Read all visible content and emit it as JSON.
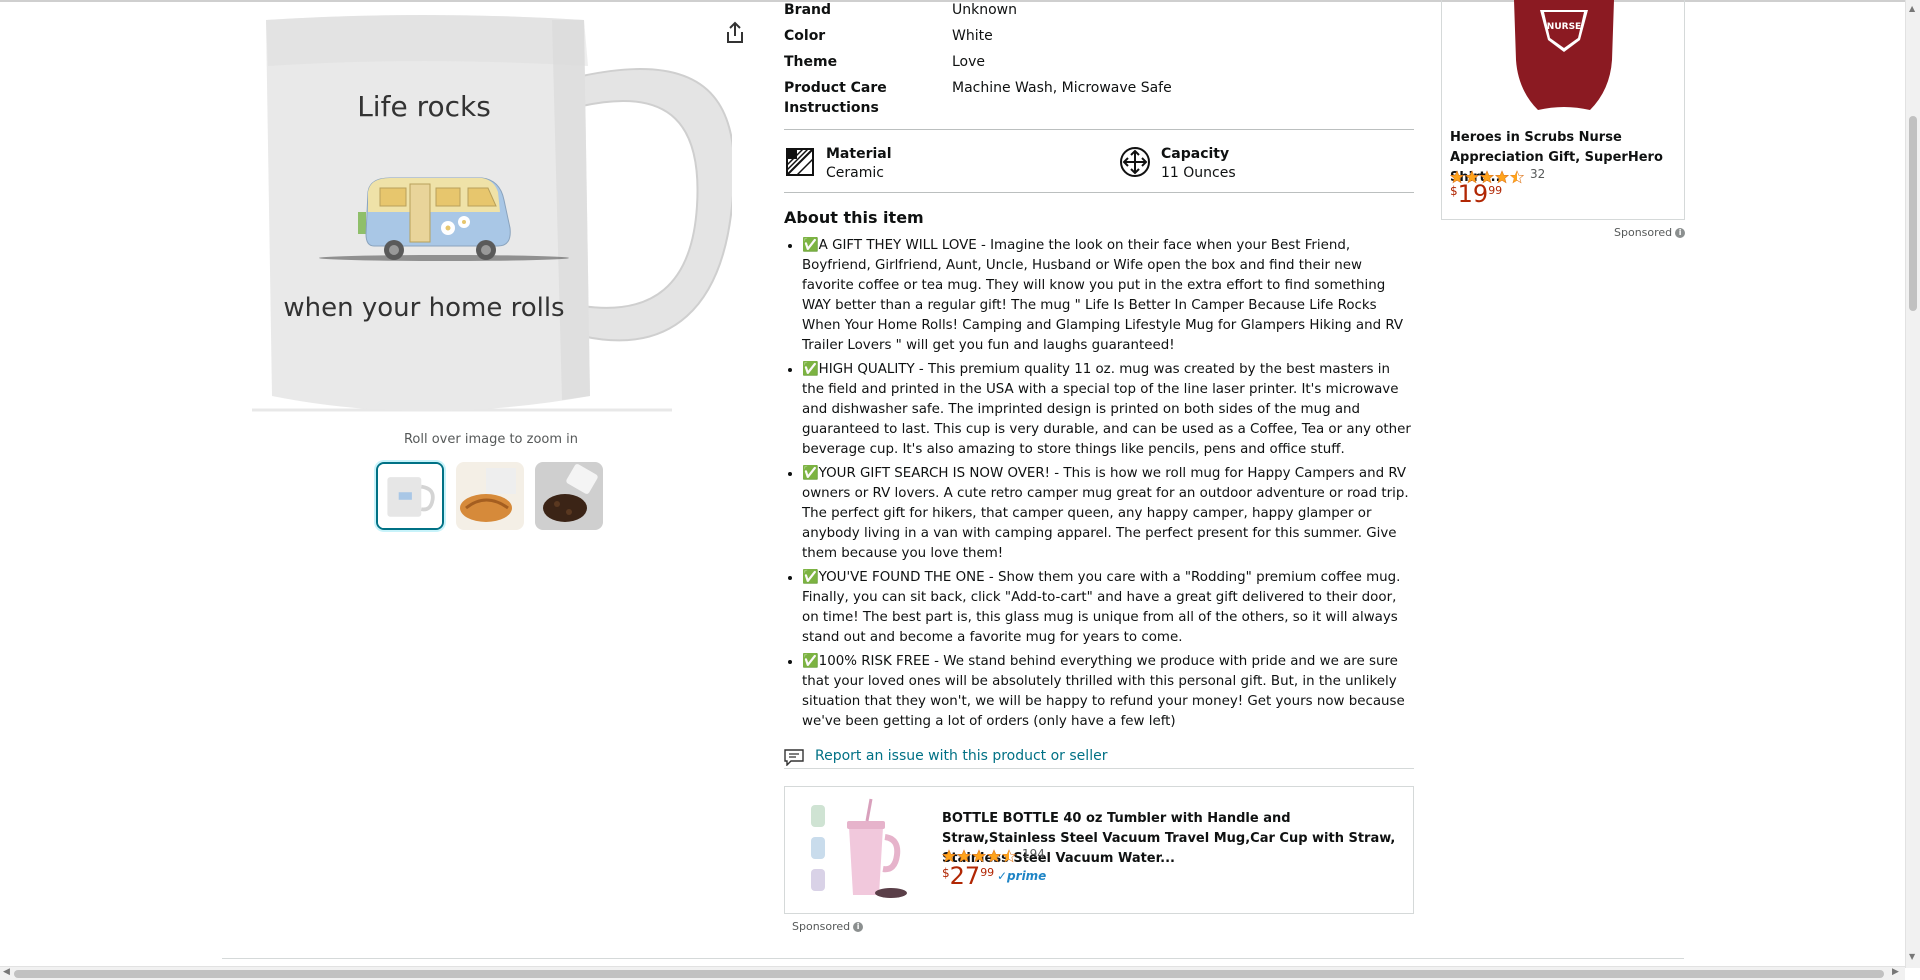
{
  "gallery": {
    "mug_text_top": "Life rocks",
    "mug_text_bottom": "when your home rolls",
    "zoom_hint": "Roll over image to zoom in"
  },
  "specs": [
    {
      "key": "Brand",
      "value": "Unknown"
    },
    {
      "key": "Color",
      "value": "White"
    },
    {
      "key": "Theme",
      "value": "Love"
    },
    {
      "key": "Product Care Instructions",
      "value": "Machine Wash, Microwave Safe"
    }
  ],
  "icon_attrs": [
    {
      "label": "Material",
      "value": "Ceramic",
      "icon": "material-icon"
    },
    {
      "label": "Capacity",
      "value": "11 Ounces",
      "icon": "capacity-icon"
    }
  ],
  "about": {
    "title": "About this item",
    "bullets": [
      "✅A GIFT THEY WILL LOVE - Imagine the look on their face when your Best Friend, Boyfriend, Girlfriend, Aunt, Uncle, Husband or Wife open the box and find their new favorite coffee or tea mug. They will know you put in the extra effort to find something WAY better than a regular gift! The mug \" Life Is Better In Camper Because Life Rocks When Your Home Rolls! Camping and Glamping Lifestyle Mug for Glampers Hiking and RV Trailer Lovers \" will get you fun and laughs guaranteed!",
      "✅HIGH QUALITY - This premium quality 11 oz. mug was created by the best masters in the field and printed in the USA with a special top of the line laser printer. It's microwave and dishwasher safe. The imprinted design is printed on both sides of the mug and guaranteed to last. This cup is very durable, and can be used as a Coffee, Tea or any other beverage cup. It's also amazing to store things like pencils, pens and office stuff.",
      "✅YOUR GIFT SEARCH IS NOW OVER! - This is how we roll mug for Happy Campers and RV owners or RV lovers. A cute retro camper mug great for an outdoor adventure or road trip. The perfect gift for hikers, that camper queen, any happy camper, happy glamper or anybody living in a van with camping apparel. The perfect present for this summer. Give them because you love them!",
      "✅YOU'VE FOUND THE ONE - Show them you care with a \"Rodding\" premium coffee mug. Finally, you can sit back, click \"Add-to-cart\" and have a great gift delivered to their door, on time! The best part is, this glass mug is unique from all of the others, so it will always stand out and become a favorite mug for years to come.",
      "✅100% RISK FREE - We stand behind everything we produce with pride and we are sure that your loved ones will be absolutely thrilled with this personal gift. But, in the unlikely situation that they won't, we will be happy to refund your money! Get yours now because we've been getting a lot of orders (only have a few left)"
    ]
  },
  "report_link": "Report an issue with this product or seller",
  "bottom_ad": {
    "title": "BOTTLE BOTTLE 40 oz Tumbler with Handle and Straw,Stainless Steel Vacuum Travel Mug,Car Cup with Straw, Stainless Steel Vacuum Water...",
    "rating": 4.5,
    "review_count": "194",
    "price_symbol": "$",
    "price_whole": "27",
    "price_fraction": "99",
    "prime": "✓prime",
    "sponsored": "Sponsored"
  },
  "side_ad": {
    "shirt_text": "NURSE",
    "title": "Heroes in Scrubs Nurse Appreciation Gift, SuperHero Shirt...",
    "rating": 4.5,
    "review_count": "32",
    "price_symbol": "$",
    "price_whole": "19",
    "price_fraction": "99",
    "sponsored": "Sponsored"
  },
  "colors": {
    "link": "#007185",
    "price": "#b12704",
    "star": "#ffa41c",
    "shirt": "#8b1a22"
  }
}
